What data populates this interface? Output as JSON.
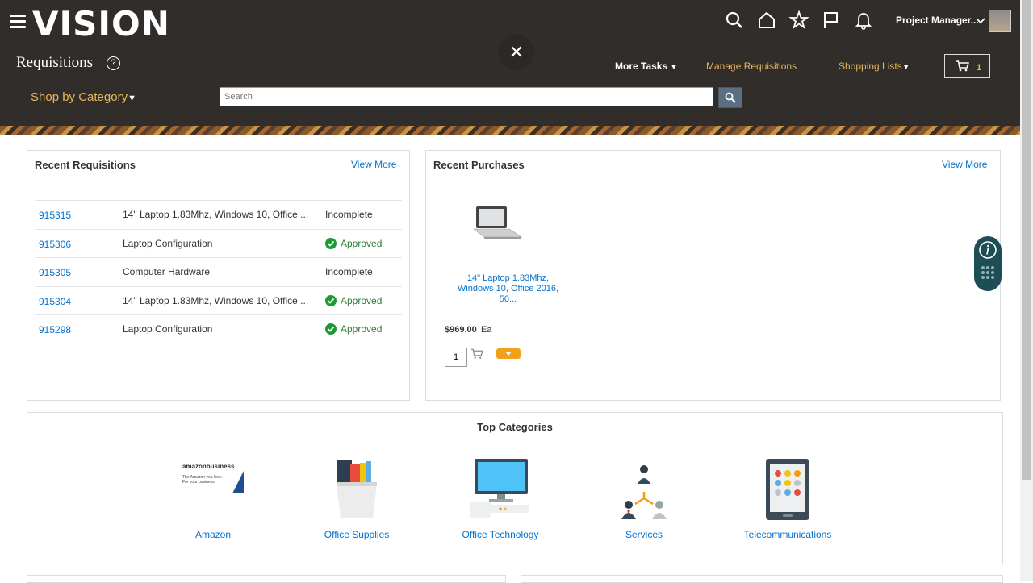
{
  "header": {
    "logo": "VISION",
    "user_name": "Project Manager...",
    "page_title": "Requisitions",
    "close_symbol": "✕",
    "more_tasks": "More Tasks",
    "manage_requisitions": "Manage Requisitions",
    "shopping_lists": "Shopping Lists",
    "cart_count": "1",
    "shop_by_category": "Shop by Category",
    "search_placeholder": "Search",
    "help_symbol": "?"
  },
  "recent_requisitions": {
    "title": "Recent Requisitions",
    "view_more": "View More",
    "rows": [
      {
        "id": "915315",
        "description": "14\" Laptop 1.83Mhz, Windows 10, Office ...",
        "status": "Incomplete"
      },
      {
        "id": "915306",
        "description": "Laptop Configuration",
        "status": "Approved"
      },
      {
        "id": "915305",
        "description": "Computer Hardware",
        "status": "Incomplete"
      },
      {
        "id": "915304",
        "description": "14\" Laptop 1.83Mhz, Windows 10, Office ...",
        "status": "Approved"
      },
      {
        "id": "915298",
        "description": "Laptop Configuration",
        "status": "Approved"
      }
    ]
  },
  "recent_purchases": {
    "title": "Recent Purchases",
    "view_more": "View More",
    "product_name_1": "14\" Laptop 1.83Mhz,",
    "product_name_2": "Windows 10, Office 2016,",
    "product_name_3": "50...",
    "price": "$969.00",
    "uom": "Ea",
    "quantity": "1"
  },
  "top_categories": {
    "title": "Top Categories",
    "amazon_logo_text": "amazonbusiness",
    "amazon_tagline_1": "The Amazon you love.",
    "amazon_tagline_2": "For your business.",
    "items": [
      "Amazon",
      "Office Supplies",
      "Office Technology",
      "Services",
      "Telecommunications"
    ]
  },
  "icons": [
    "hamburger-menu-icon",
    "search-icon",
    "home-icon",
    "star-icon",
    "flag-icon",
    "bell-icon",
    "chevron-down-icon",
    "help-icon",
    "close-icon",
    "cart-icon",
    "check-circle-icon",
    "info-icon",
    "grid-icon"
  ],
  "colors": {
    "header_bg": "#312d2a",
    "link": "#0572ce",
    "gold": "#e7b65b",
    "approved": "#1a9b34",
    "accent_orange": "#f0a01a"
  }
}
